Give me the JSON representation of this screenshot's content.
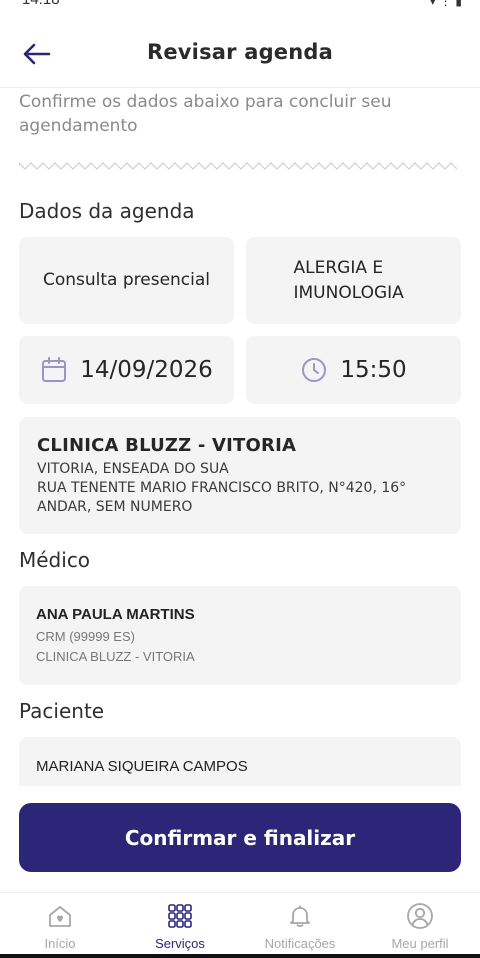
{
  "status_bar": {
    "time": "14:18",
    "icons": [
      "wifi-icon",
      "signal-icon",
      "battery-icon"
    ]
  },
  "header": {
    "title": "Revisar agenda",
    "back_icon": "arrow-left-icon"
  },
  "intro_text": "Confirme os dados abaixo para concluir seu agendamento",
  "schedule": {
    "section_title": "Dados da agenda",
    "appointment_type": "Consulta presencial",
    "specialty": "ALERGIA E IMUNOLOGIA",
    "date": "14/09/2026",
    "time": "15:50",
    "clinic": {
      "name": "CLINICA BLUZZ - VITORIA",
      "district": "VITORIA, ENSEADA DO SUA",
      "address": "RUA TENENTE MARIO FRANCISCO BRITO, N°420, 16° ANDAR, SEM NUMERO"
    }
  },
  "doctor": {
    "section_title": "Médico",
    "name": "ANA PAULA MARTINS",
    "crm": "CRM (99999 ES)",
    "clinic": "CLINICA BLUZZ - VITORIA"
  },
  "patient": {
    "section_title": "Paciente",
    "name": "MARIANA SIQUEIRA CAMPOS"
  },
  "confirm_button": "Confirmar e finalizar",
  "bottom_nav": [
    {
      "label": "Início",
      "icon": "home-heart-icon",
      "active": false
    },
    {
      "label": "Serviços",
      "icon": "grid-dots-icon",
      "active": true
    },
    {
      "label": "Notificações",
      "icon": "bell-icon",
      "active": false
    },
    {
      "label": "Meu perfil",
      "icon": "user-circle-icon",
      "active": false
    }
  ],
  "colors": {
    "primary": "#2c2578",
    "accent_icon": "#9b93c9",
    "card_bg": "#f4f4f4"
  }
}
